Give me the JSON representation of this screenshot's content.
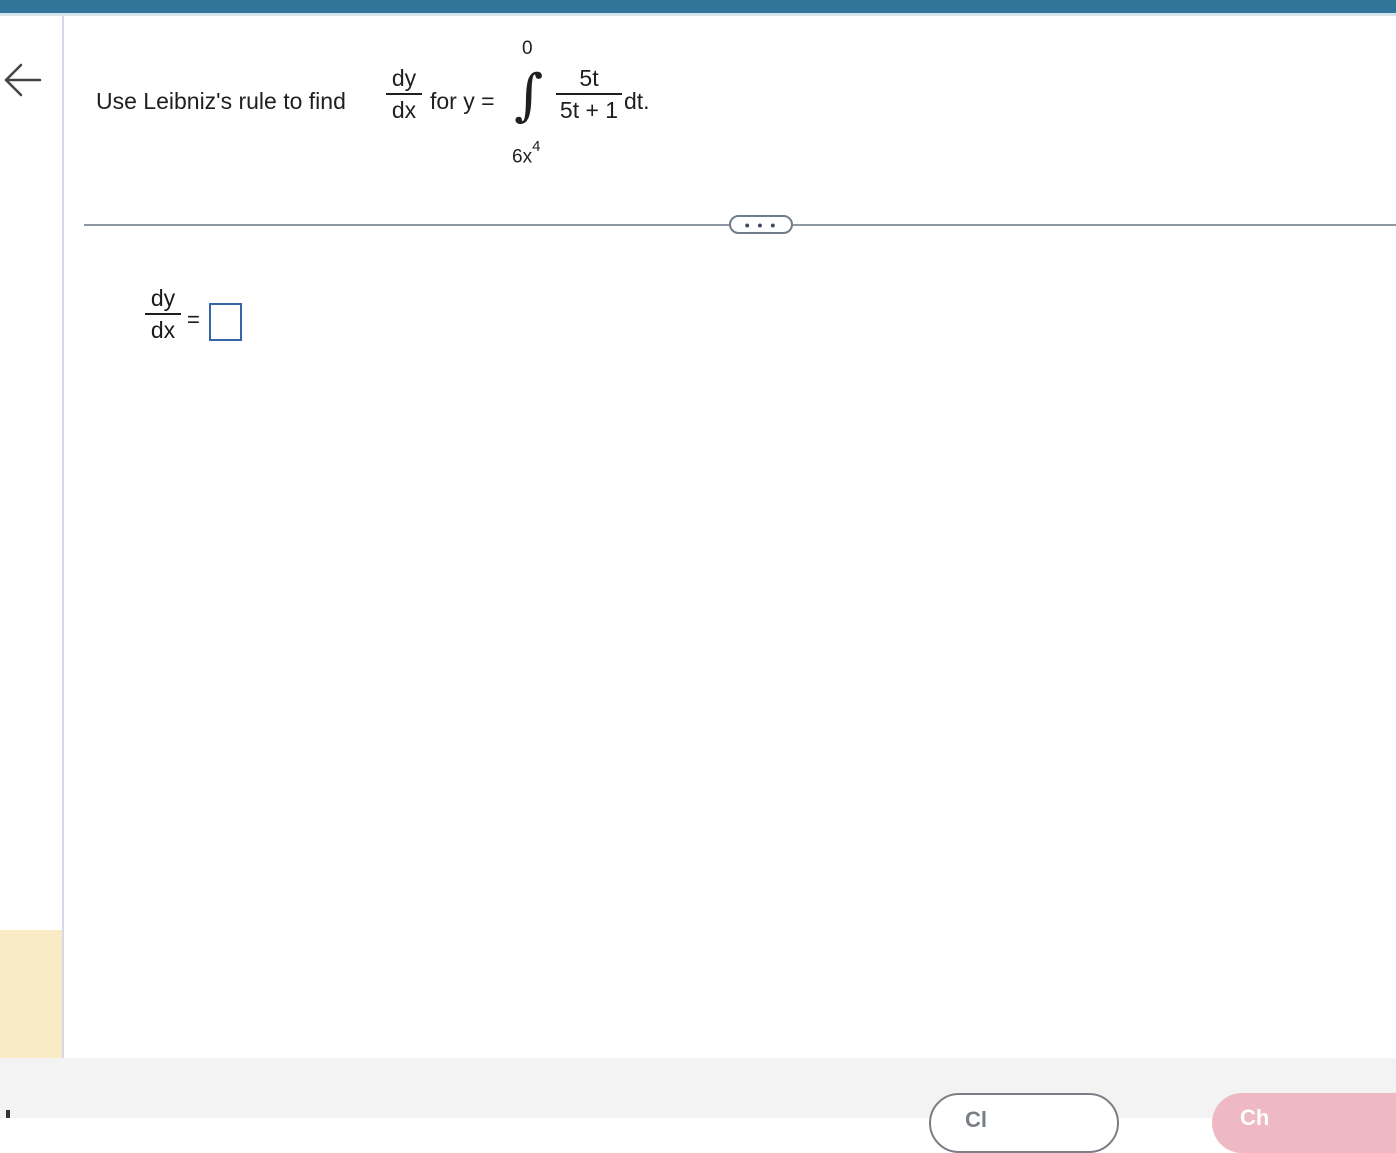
{
  "question": {
    "prefix": "Use Leibniz's rule to find",
    "frac_num": "dy",
    "frac_den": "dx",
    "middle": "for y =",
    "integral_upper": "0",
    "integral_lower_base": "6x",
    "integral_lower_exp": "4",
    "integrand_num": "5t",
    "integrand_den": "5t + 1",
    "suffix": "dt."
  },
  "toolbar": {
    "more_label": "• • •"
  },
  "answer": {
    "frac_num": "dy",
    "frac_den": "dx",
    "equals": "=",
    "value": ""
  },
  "footer": {
    "left_button_label": "Cl",
    "right_button_label": "Ch"
  },
  "colors": {
    "top_bar": "#2f7698",
    "answer_box_border": "#3566a8",
    "rail_highlight": "#f8ebc6",
    "primary_button": "#efb9c3"
  },
  "icons": {
    "back": "arrow-left-icon",
    "more": "ellipsis-icon"
  }
}
